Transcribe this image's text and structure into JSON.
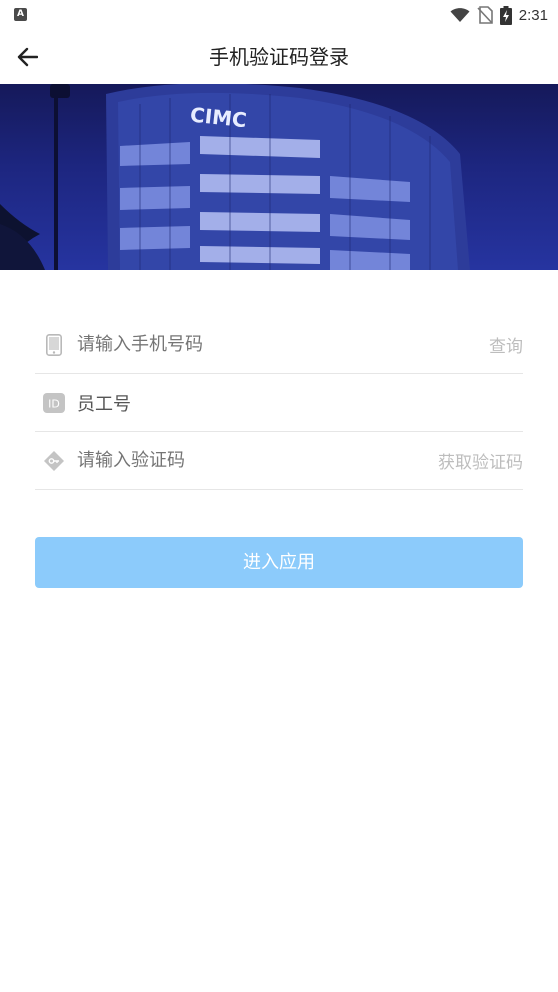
{
  "status_bar": {
    "notification_icon_letter": "A",
    "time": "2:31",
    "icons": [
      "wifi-icon",
      "no-sim-icon",
      "battery-charging-icon"
    ]
  },
  "header": {
    "title": "手机验证码登录",
    "back_icon": "arrow-left-icon"
  },
  "banner": {
    "sign_text": "CIMC"
  },
  "form": {
    "phone": {
      "placeholder": "请输入手机号码",
      "action": "查询",
      "icon": "phone-icon"
    },
    "employee_id": {
      "value": "员工号",
      "icon": "id-badge-icon",
      "icon_text": "ID"
    },
    "code": {
      "placeholder": "请输入验证码",
      "action": "获取验证码",
      "icon": "shield-key-icon"
    }
  },
  "submit": {
    "label": "进入应用",
    "color": "#8ccbfb"
  }
}
